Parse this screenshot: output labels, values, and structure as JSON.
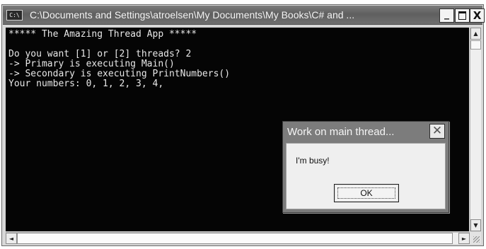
{
  "window": {
    "title": "C:\\Documents and Settings\\atroelsen\\My Documents\\My Books\\C# and ...",
    "system_icon": "C:\\",
    "controls": {
      "minimize": "_",
      "maximize": "□",
      "close": "X"
    }
  },
  "console": {
    "background": "#050505",
    "foreground": "#e8e8e8",
    "lines": [
      "***** The Amazing Thread App *****",
      "",
      "Do you want [1] or [2] threads? 2",
      "-> Primary is executing Main()",
      "-> Secondary is executing PrintNumbers()",
      "Your numbers: 0, 1, 2, 3, 4,"
    ]
  },
  "scrollbars": {
    "up_arrow": "▲",
    "down_arrow": "▼",
    "left_arrow": "◄",
    "right_arrow": "►"
  },
  "dialog": {
    "title": "Work on main thread...",
    "close": "✕",
    "message": "I'm busy!",
    "ok_label": "OK"
  }
}
